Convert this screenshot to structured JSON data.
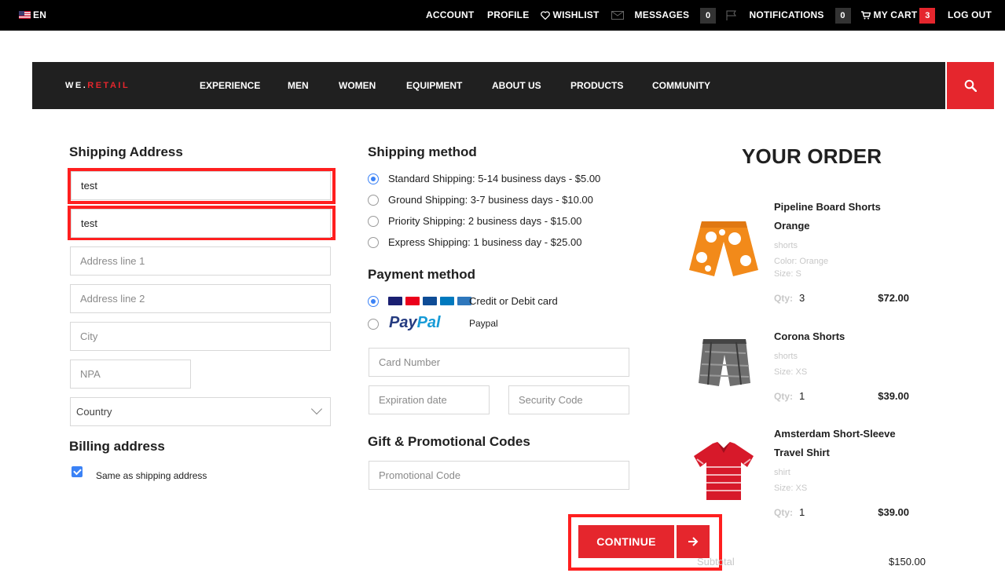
{
  "topbar": {
    "language": "EN",
    "account": "ACCOUNT",
    "profile": "PROFILE",
    "wishlist": "WISHLIST",
    "messages": "MESSAGES",
    "messages_count": "0",
    "notifications": "NOTIFICATIONS",
    "notifications_count": "0",
    "cart": "MY CART",
    "cart_count": "3",
    "logout": "LOG OUT"
  },
  "nav": {
    "logo_a": "WE.",
    "logo_b": "RETAIL",
    "items": [
      "EXPERIENCE",
      "MEN",
      "WOMEN",
      "EQUIPMENT",
      "ABOUT US",
      "PRODUCTS",
      "COMMUNITY"
    ]
  },
  "shipping_address": {
    "title": "Shipping Address",
    "first_name_value": "test",
    "last_name_value": "test",
    "address1_placeholder": "Address line 1",
    "address2_placeholder": "Address line 2",
    "city_placeholder": "City",
    "npa_placeholder": "NPA",
    "country_selected": "Country"
  },
  "billing": {
    "title": "Billing address",
    "same_as_shipping_label": "Same as shipping address",
    "same_as_shipping_checked": true
  },
  "shipping_method": {
    "title": "Shipping method",
    "options": [
      {
        "label": "Standard Shipping: 5-14 business days - $5.00",
        "selected": true
      },
      {
        "label": "Ground Shipping: 3-7 business days - $10.00",
        "selected": false
      },
      {
        "label": "Priority Shipping: 2 business days - $15.00",
        "selected": false
      },
      {
        "label": "Express Shipping: 1 business day - $25.00",
        "selected": false
      }
    ]
  },
  "payment_method": {
    "title": "Payment method",
    "card_label": "Credit or Debit card",
    "paypal_logo_a": "Pay",
    "paypal_logo_b": "Pal",
    "paypal_label": "Paypal",
    "card_colors": [
      "#1a1f71",
      "#eb001b",
      "#0e4c96",
      "#0079be",
      "#2e77bc"
    ],
    "card_number_placeholder": "Card Number",
    "expiration_placeholder": "Expiration date",
    "security_placeholder": "Security Code"
  },
  "promo": {
    "title": "Gift & Promotional Codes",
    "placeholder": "Promotional Code"
  },
  "continue_label": "CONTINUE",
  "order": {
    "title": "YOUR ORDER",
    "items": [
      {
        "name": "Pipeline Board Shorts Orange",
        "category": "shorts",
        "color": "Color: Orange",
        "size": "Size: S",
        "qty_label": "Qty:",
        "qty": "3",
        "price": "$72.00"
      },
      {
        "name": "Corona Shorts",
        "category": "shorts",
        "size": "Size: XS",
        "qty_label": "Qty:",
        "qty": "1",
        "price": "$39.00"
      },
      {
        "name": "Amsterdam Short-Sleeve Travel Shirt",
        "category": "shirt",
        "size": "Size: XS",
        "qty_label": "Qty:",
        "qty": "1",
        "price": "$39.00"
      }
    ],
    "subtotal_label": "Subtotal",
    "subtotal_value": "$150.00"
  },
  "colors": {
    "accent_red": "#e5262d",
    "highlight_red": "#ff1f1f",
    "radio_blue": "#3b82f6",
    "topbar_bg": "#000000",
    "nav_bg": "#202020"
  }
}
